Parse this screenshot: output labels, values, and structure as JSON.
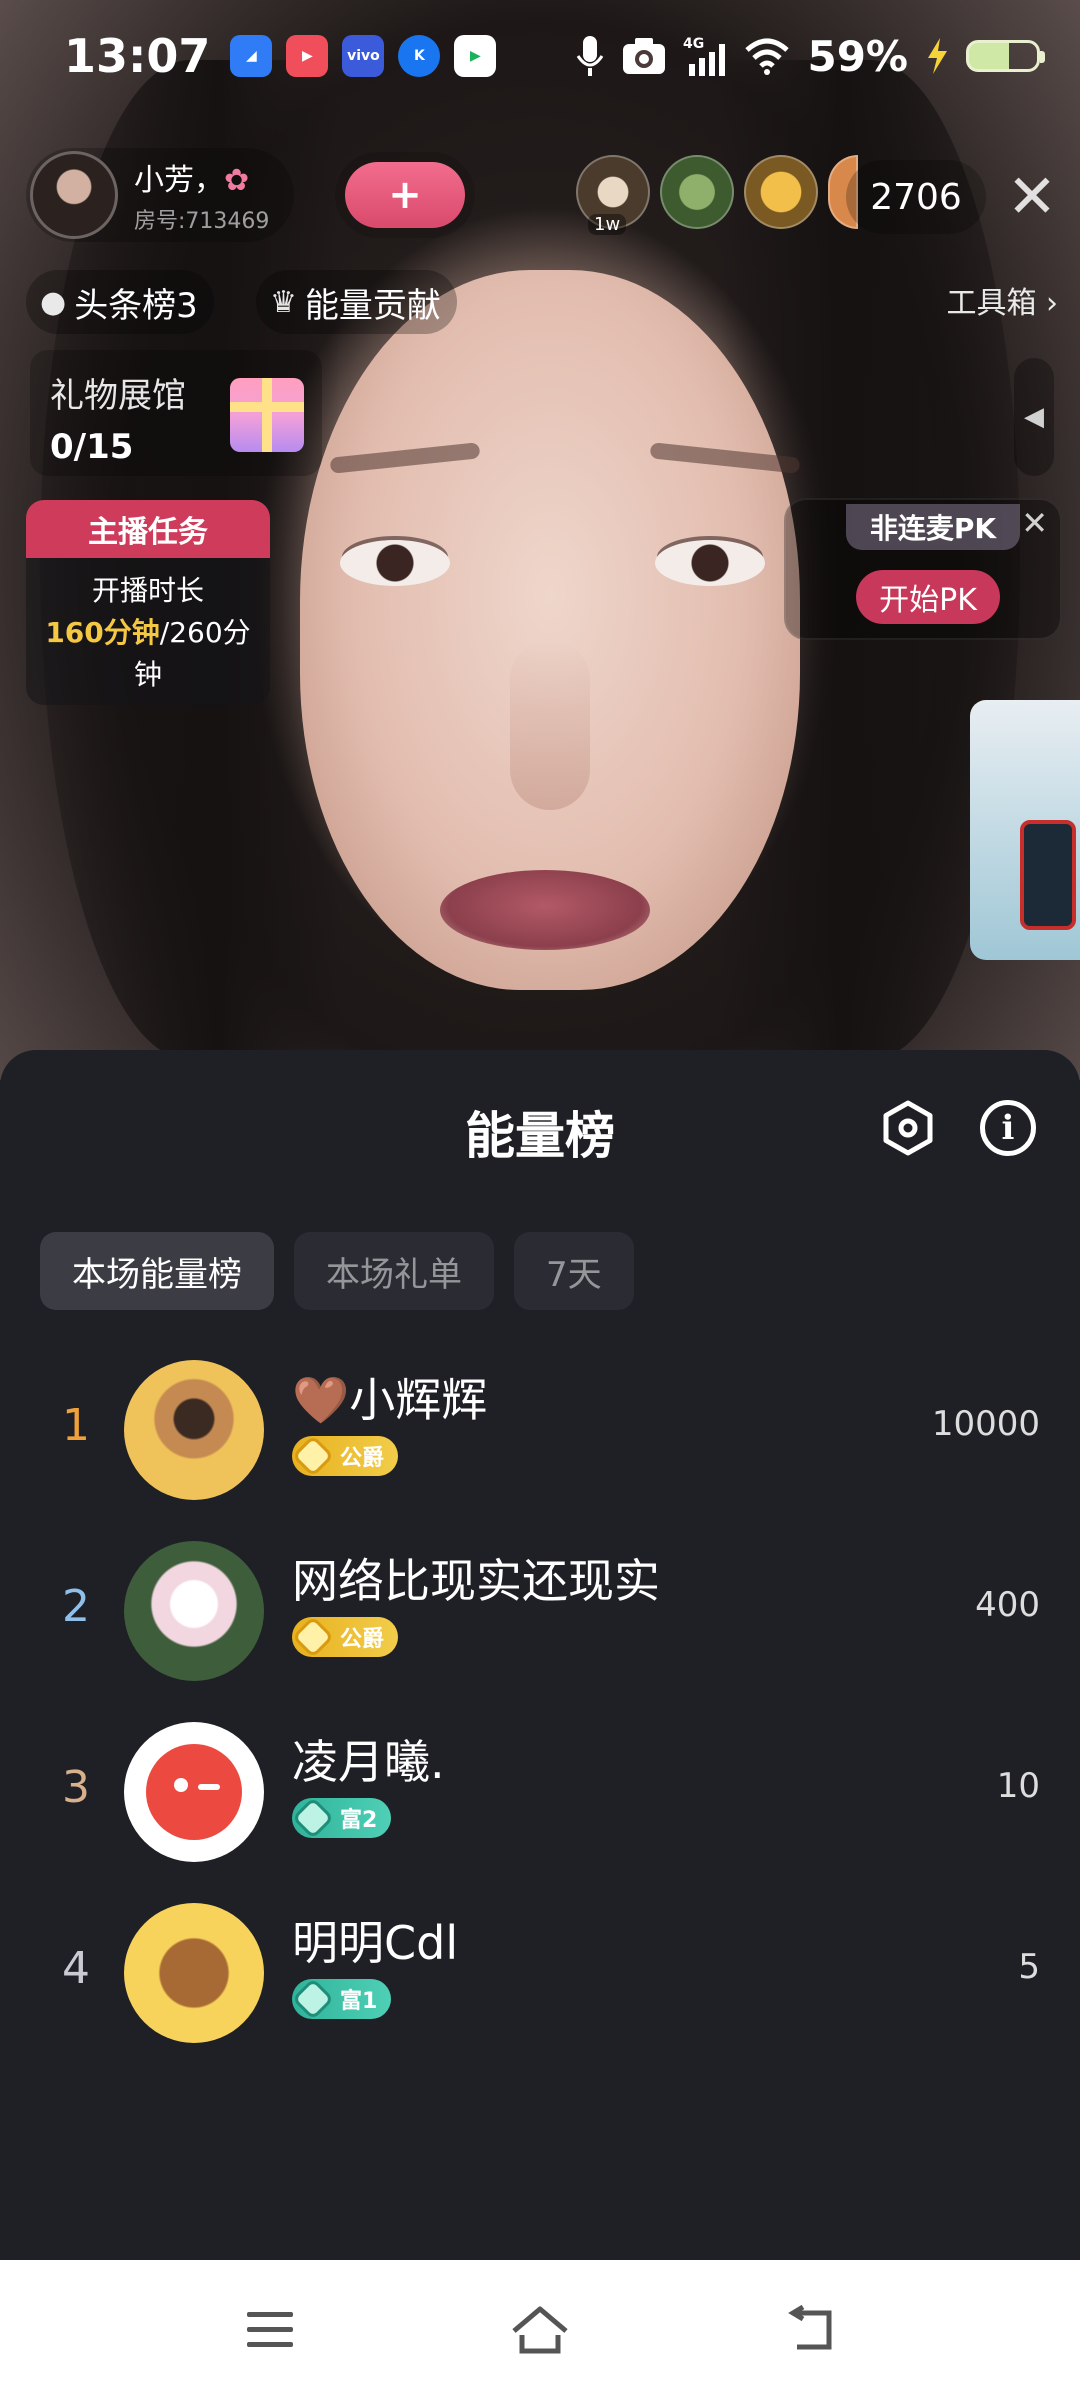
{
  "status_bar": {
    "time": "13:07",
    "battery_percent": "59%",
    "network": "4G",
    "app_icons": [
      "app-1",
      "app-2",
      "vivo",
      "app-4",
      "app-5"
    ]
  },
  "live": {
    "host": {
      "name": "小芳，",
      "room": "房号:713469"
    },
    "viewer_tag": "1w",
    "viewer_count": "2706",
    "pills": {
      "headline_rank": "头条榜3",
      "energy_contribution": "能量贡献"
    },
    "toolbox": "工具箱",
    "gift_hall": {
      "title": "礼物展馆",
      "count": "0/15"
    },
    "host_task": {
      "title": "主播任务",
      "line1": "开播时长",
      "progress_done": "160分钟",
      "progress_total": "/260分",
      "line3": "钟"
    },
    "pk": {
      "title": "非连麦PK",
      "start_label": "开始PK"
    }
  },
  "sheet": {
    "title": "能量榜",
    "tabs": [
      {
        "label": "本场能量榜",
        "active": true
      },
      {
        "label": "本场礼单",
        "active": false
      },
      {
        "label": "7天",
        "active": false
      }
    ],
    "ranking": [
      {
        "rank": "1",
        "name": "🤎小辉辉",
        "badge": "公爵",
        "badge_style": "gold",
        "score": "10000",
        "rank_color": "#f0a23a"
      },
      {
        "rank": "2",
        "name": "网络比现实还现实",
        "badge": "公爵",
        "badge_style": "gold",
        "score": "400",
        "rank_color": "#8fc0ea"
      },
      {
        "rank": "3",
        "name": "凌月曦.",
        "badge": "富2",
        "badge_style": "teal",
        "score": "10",
        "rank_color": "#d8b08c"
      },
      {
        "rank": "4",
        "name": "明明Cdl",
        "badge": "富1",
        "badge_style": "teal",
        "score": "5",
        "rank_color": "#c9cbd2"
      }
    ]
  },
  "colors": {
    "sheet_bg": "#1f2026",
    "tab_bg": "#2b2c33",
    "accent_pink": "#d94a6b",
    "task_header": "#cf3b5a",
    "task_highlight": "#f5c843"
  }
}
